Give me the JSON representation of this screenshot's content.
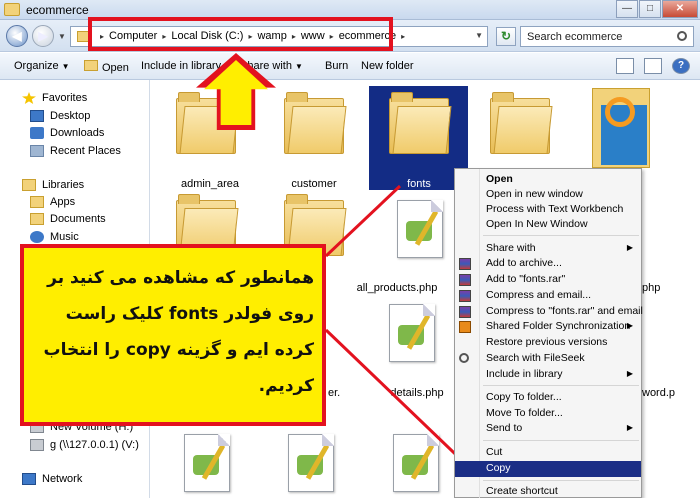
{
  "window": {
    "title": "ecommerce"
  },
  "address": {
    "crumbs": [
      "Computer",
      "Local Disk (C:)",
      "wamp",
      "www",
      "ecommerce"
    ],
    "search_placeholder": "Search ecommerce"
  },
  "toolbar": {
    "organize": "Organize",
    "open": "Open",
    "include_in_library": "Include in library",
    "share_with": "Share with",
    "burn": "Burn",
    "new_folder": "New folder"
  },
  "nav": {
    "favorites": "Favorites",
    "desktop": "Desktop",
    "downloads": "Downloads",
    "recent_places": "Recent Places",
    "libraries": "Libraries",
    "apps": "Apps",
    "documents": "Documents",
    "music": "Music",
    "new_volume": "New Volume (H:)",
    "net_drive": "g (\\\\127.0.0.1) (V:)",
    "network": "Network"
  },
  "files": {
    "admin_area": "admin_area",
    "customer": "customer",
    "fonts": "fonts",
    "all_products": "all_products.php",
    "details": "details.php",
    "partial_php": "php",
    "partial_word": "word.p",
    "partial_er": "er."
  },
  "callout": {
    "text": "همانطور که مشاهده می کنید بر روی فولدر fonts کلیک راست کرده ایم و گزینه copy را انتخاب کردیم."
  },
  "context_menu": {
    "open": "Open",
    "open_new_window": "Open in new window",
    "process_text_workbench": "Process with Text Workbench",
    "open_in_new_window": "Open In New Window",
    "share_with": "Share with",
    "add_to_archive": "Add to archive...",
    "add_to_fonts_rar": "Add to \"fonts.rar\"",
    "compress_email": "Compress and email...",
    "compress_fonts_email": "Compress to \"fonts.rar\" and email",
    "shared_folder_sync": "Shared Folder Synchronization",
    "restore_versions": "Restore previous versions",
    "search_fileseek": "Search with FileSeek",
    "include_in_library": "Include in library",
    "copy_to_folder": "Copy To folder...",
    "move_to_folder": "Move To folder...",
    "send_to": "Send to",
    "cut": "Cut",
    "copy": "Copy",
    "create_shortcut": "Create shortcut"
  },
  "colors": {
    "annotation_red": "#e3121f",
    "annotation_yellow": "#ffee00",
    "selection": "#132c85",
    "menu_highlight": "#1b2e86"
  }
}
